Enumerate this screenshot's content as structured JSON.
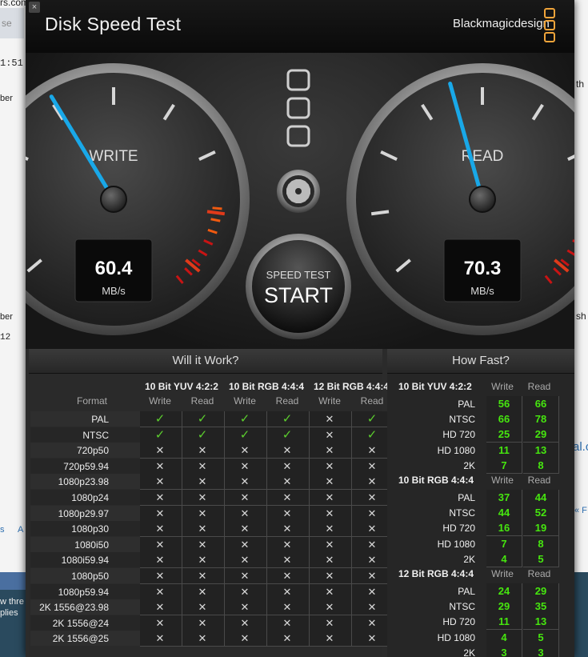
{
  "app": {
    "title": "Disk Speed Test",
    "brand": "Blackmagicdesign",
    "close_glyph": "×",
    "accent_color": "#f0a43a"
  },
  "gauges": {
    "write": {
      "label": "WRITE",
      "value": "60.4",
      "unit": "MB/s",
      "needle_fraction": 0.38
    },
    "read": {
      "label": "READ",
      "value": "70.3",
      "unit": "MB/s",
      "needle_fraction": 0.44
    },
    "start_button": {
      "top_label": "SPEED TEST",
      "main_label": "START"
    },
    "settings_icon": "gear-icon"
  },
  "will_it_work": {
    "title": "Will it Work?",
    "format_header": "Format",
    "groups": [
      "10 Bit YUV 4:2:2",
      "10 Bit RGB 4:4:4",
      "12 Bit RGB 4:4:4"
    ],
    "sub_headers": [
      "Write",
      "Read",
      "Write",
      "Read",
      "Write",
      "Read"
    ],
    "check_glyph": "✓",
    "cross_glyph": "✕",
    "rows": [
      {
        "format": "PAL",
        "marks": [
          true,
          true,
          true,
          true,
          false,
          true
        ]
      },
      {
        "format": "NTSC",
        "marks": [
          true,
          true,
          true,
          true,
          false,
          true
        ]
      },
      {
        "format": "720p50",
        "marks": [
          false,
          false,
          false,
          false,
          false,
          false
        ]
      },
      {
        "format": "720p59.94",
        "marks": [
          false,
          false,
          false,
          false,
          false,
          false
        ]
      },
      {
        "format": "1080p23.98",
        "marks": [
          false,
          false,
          false,
          false,
          false,
          false
        ]
      },
      {
        "format": "1080p24",
        "marks": [
          false,
          false,
          false,
          false,
          false,
          false
        ]
      },
      {
        "format": "1080p29.97",
        "marks": [
          false,
          false,
          false,
          false,
          false,
          false
        ]
      },
      {
        "format": "1080p30",
        "marks": [
          false,
          false,
          false,
          false,
          false,
          false
        ]
      },
      {
        "format": "1080i50",
        "marks": [
          false,
          false,
          false,
          false,
          false,
          false
        ]
      },
      {
        "format": "1080i59.94",
        "marks": [
          false,
          false,
          false,
          false,
          false,
          false
        ]
      },
      {
        "format": "1080p50",
        "marks": [
          false,
          false,
          false,
          false,
          false,
          false
        ]
      },
      {
        "format": "1080p59.94",
        "marks": [
          false,
          false,
          false,
          false,
          false,
          false
        ]
      },
      {
        "format": "2K 1556@23.98",
        "marks": [
          false,
          false,
          false,
          false,
          false,
          false
        ]
      },
      {
        "format": "2K 1556@24",
        "marks": [
          false,
          false,
          false,
          false,
          false,
          false
        ]
      },
      {
        "format": "2K 1556@25",
        "marks": [
          false,
          false,
          false,
          false,
          false,
          false
        ]
      }
    ]
  },
  "how_fast": {
    "title": "How Fast?",
    "col_write": "Write",
    "col_read": "Read",
    "groups": [
      {
        "name": "10 Bit YUV 4:2:2",
        "rows": [
          {
            "label": "PAL",
            "write": "56",
            "read": "66"
          },
          {
            "label": "NTSC",
            "write": "66",
            "read": "78"
          },
          {
            "label": "HD 720",
            "write": "25",
            "read": "29"
          },
          {
            "label": "HD 1080",
            "write": "11",
            "read": "13"
          },
          {
            "label": "2K",
            "write": "7",
            "read": "8"
          }
        ]
      },
      {
        "name": "10 Bit RGB 4:4:4",
        "rows": [
          {
            "label": "PAL",
            "write": "37",
            "read": "44"
          },
          {
            "label": "NTSC",
            "write": "44",
            "read": "52"
          },
          {
            "label": "HD 720",
            "write": "16",
            "read": "19"
          },
          {
            "label": "HD 1080",
            "write": "7",
            "read": "8"
          },
          {
            "label": "2K",
            "write": "4",
            "read": "5"
          }
        ]
      },
      {
        "name": "12 Bit RGB 4:4:4",
        "rows": [
          {
            "label": "PAL",
            "write": "24",
            "read": "29"
          },
          {
            "label": "NTSC",
            "write": "29",
            "read": "35"
          },
          {
            "label": "HD 720",
            "write": "11",
            "read": "13"
          },
          {
            "label": "HD 1080",
            "write": "4",
            "read": "5"
          },
          {
            "label": "2K",
            "write": "3",
            "read": "3"
          }
        ]
      }
    ]
  },
  "background": {
    "fragments": [
      "rs.com",
      "se",
      "1:51",
      "ber",
      "th",
      "ber",
      "sh",
      "12",
      "al.c",
      "« F",
      "s",
      "A",
      "w thre",
      "plies"
    ]
  }
}
